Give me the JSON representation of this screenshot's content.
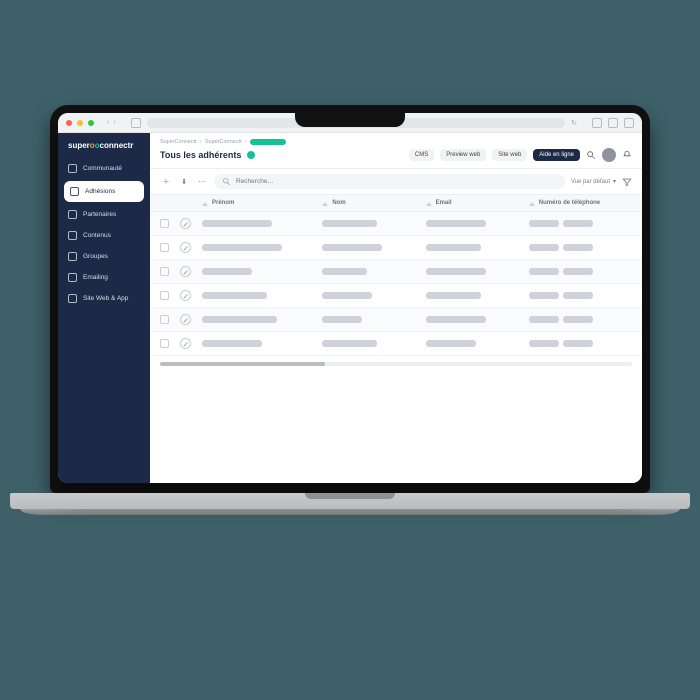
{
  "brand": {
    "part1": "super",
    "part2": "connectr"
  },
  "sidebar": {
    "items": [
      {
        "label": "Communauté",
        "icon": "globe-icon"
      },
      {
        "label": "Adhésions",
        "icon": "card-icon",
        "active": true
      },
      {
        "label": "Partenaires",
        "icon": "handshake-icon"
      },
      {
        "label": "Contenus",
        "icon": "news-icon"
      },
      {
        "label": "Groupes",
        "icon": "group-icon"
      },
      {
        "label": "Emailing",
        "icon": "mail-icon"
      },
      {
        "label": "Site Web & App",
        "icon": "monitor-icon"
      }
    ]
  },
  "breadcrumbs": {
    "a": "SuperConnectr",
    "b": "SuperConnectr"
  },
  "page_title": "Tous les adhérents",
  "top_actions": {
    "cms": "CMS",
    "preview": "Preview web",
    "site": "Site web",
    "help": "Aide en ligne"
  },
  "toolbar": {
    "search_placeholder": "Recherche…",
    "view_label": "Vue par défaut"
  },
  "columns": {
    "prenom": "Prénom",
    "nom": "Nom",
    "email": "Email",
    "tel": "Numéro de téléphone"
  }
}
